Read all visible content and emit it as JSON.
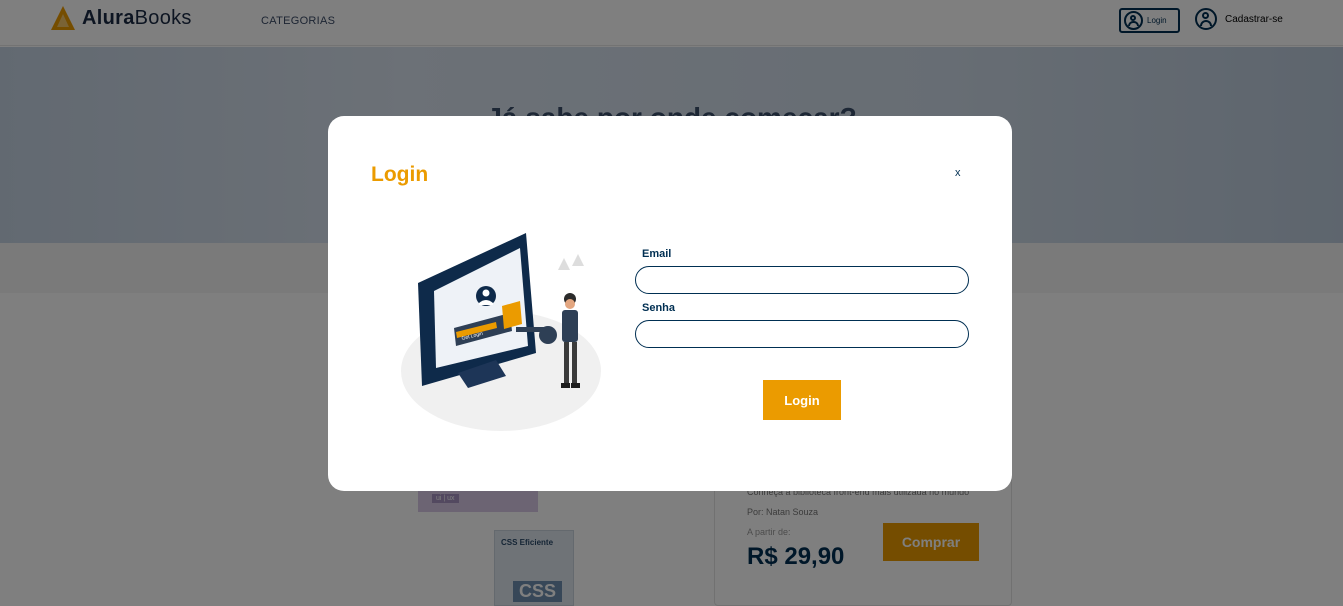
{
  "header": {
    "logo_prefix": "Alura",
    "logo_suffix": "Books",
    "nav_categories": "CATEGORIAS",
    "login_label": "Login",
    "signup_label": "Cadastrar-se"
  },
  "banner": {
    "title": "Já sabe por onde começar?"
  },
  "book": {
    "cover1_tag": "ui | ux",
    "cover2_title": "CSS Eficiente",
    "cover2_badge": "CSS",
    "description": "Conheça a biblioteca front-end mais utilizada no mundo",
    "author": "Por: Natan Souza",
    "from_label": "A partir de:",
    "price": "R$ 29,90",
    "buy_label": "Comprar"
  },
  "modal": {
    "title": "Login",
    "close_label": "x",
    "email_label": "Email",
    "email_value": "",
    "password_label": "Senha",
    "password_value": "",
    "submit_label": "Login",
    "illustration_text": "Get Login"
  },
  "colors": {
    "accent": "#eb9b00",
    "primary": "#002f52",
    "overlay": "rgba(0,0,0,0.5)"
  }
}
